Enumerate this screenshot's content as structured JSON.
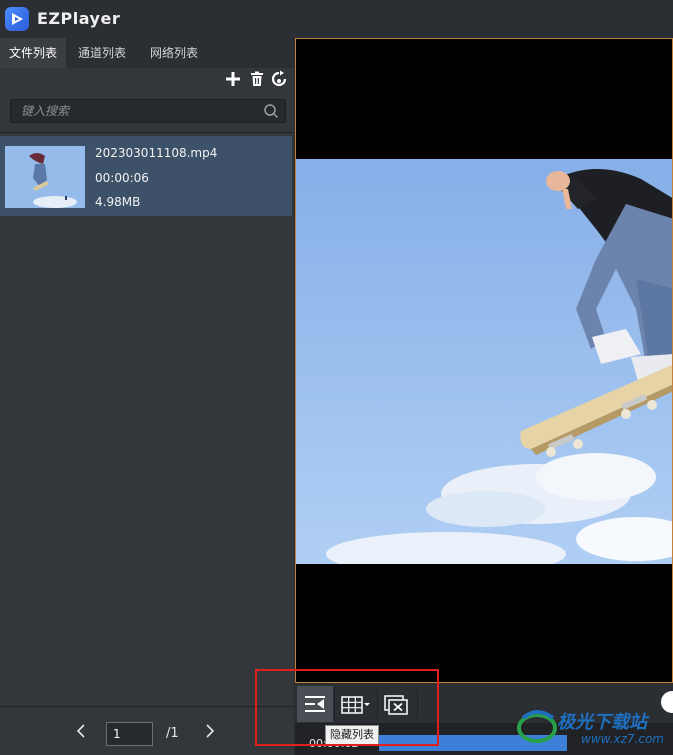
{
  "app": {
    "title": "EZPlayer"
  },
  "tabs": [
    "文件列表",
    "通道列表",
    "网络列表"
  ],
  "toolbar": {
    "icons": [
      "plus-icon",
      "trash-icon",
      "refresh-icon"
    ]
  },
  "search": {
    "placeholder": "键入搜索"
  },
  "files": [
    {
      "name": "202303011108.mp4",
      "duration": "00:00:06",
      "size": "4.98MB"
    }
  ],
  "pager": {
    "current": "1",
    "total": "/1"
  },
  "controls": {
    "tooltip": "隐藏列表",
    "time": "00:00:02"
  },
  "watermark": {
    "text": "极光下载站",
    "url": "www.xz7.com"
  },
  "colors": {
    "accent": "#3e7fd9",
    "selected_row": "#3d5168",
    "highlight": "#e01f1f",
    "player_border": "#c1803d"
  }
}
